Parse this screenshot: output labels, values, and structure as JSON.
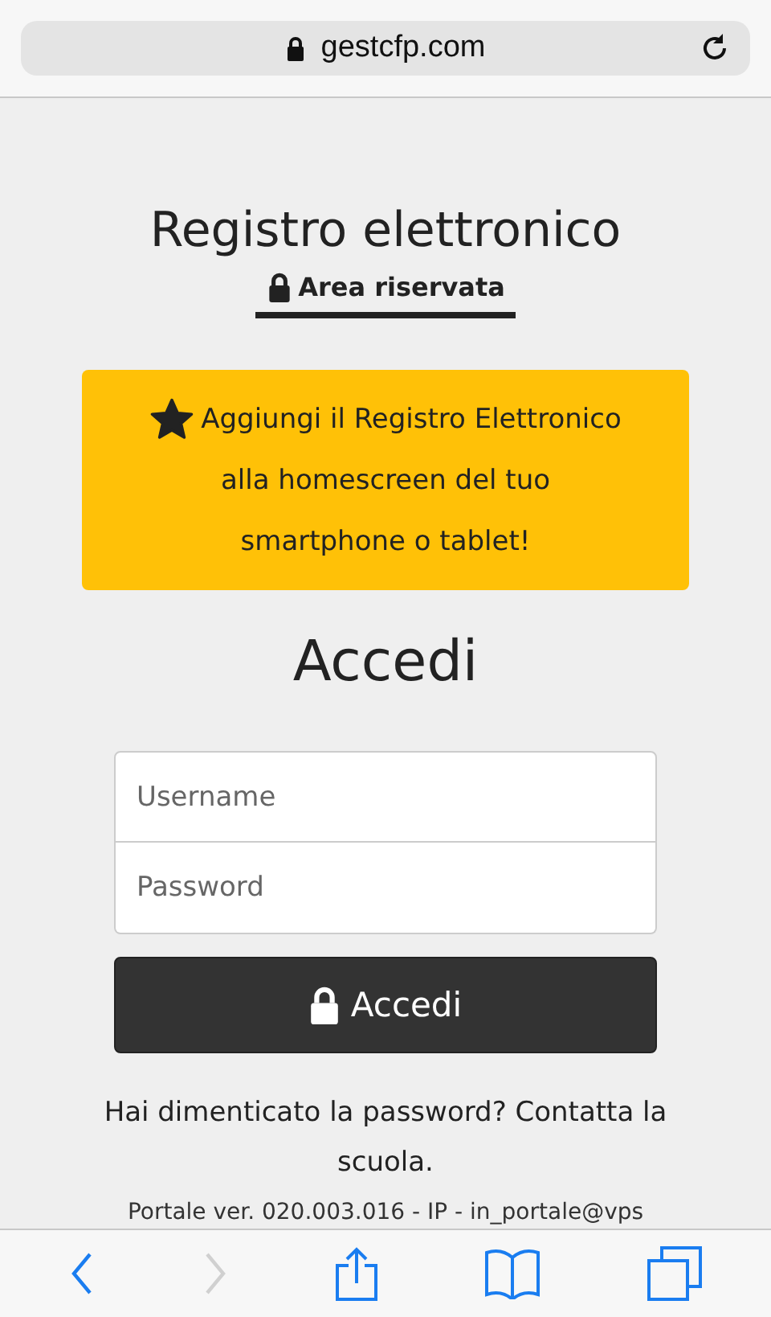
{
  "address_bar": {
    "url": "gestcfp.com"
  },
  "header": {
    "title": "Registro elettronico",
    "subtitle": "Area riservata"
  },
  "banner": {
    "lines": [
      "Aggiungi il Registro Elettronico",
      "alla homescreen del tuo",
      "smartphone o tablet!"
    ]
  },
  "login": {
    "heading": "Accedi",
    "username": {
      "placeholder": "Username"
    },
    "password": {
      "placeholder": "Password"
    },
    "button": "Accedi"
  },
  "help_text": "Hai dimenticato la password? Contatta la scuola.",
  "footer": "Portale ver. 020.003.016 - IP - in_portale@vps",
  "toolbar": {
    "forward_disabled": true
  }
}
